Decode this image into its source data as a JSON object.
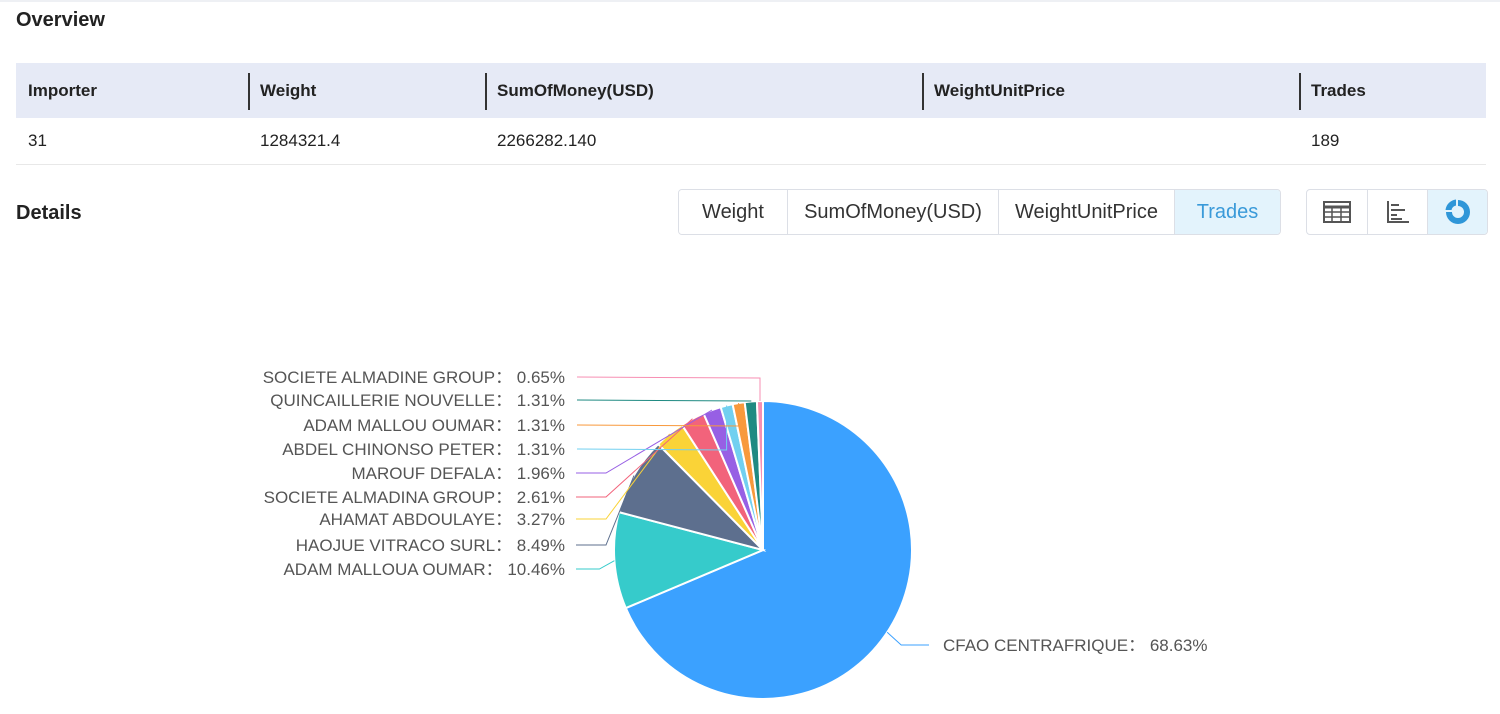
{
  "overview": {
    "title": "Overview",
    "columns": [
      "Importer",
      "Weight",
      "SumOfMoney(USD)",
      "WeightUnitPrice",
      "Trades"
    ],
    "row": [
      "31",
      "1284321.4",
      "2266282.140",
      "",
      "189"
    ]
  },
  "details": {
    "title": "Details",
    "metric_tabs": [
      "Weight",
      "SumOfMoney(USD)",
      "WeightUnitPrice",
      "Trades"
    ],
    "active_metric": "Trades",
    "view_icons": [
      "table-view-icon",
      "bar-chart-icon",
      "pie-chart-icon"
    ],
    "active_view": "pie-chart-icon"
  },
  "chart_data": {
    "type": "pie",
    "series": [
      {
        "label": "CFAO CENTRAFRIQUE",
        "value": 68.63,
        "display": "68.63%",
        "color": "#3ba1ff"
      },
      {
        "label": "ADAM MALLOUA OUMAR",
        "value": 10.46,
        "display": "10.46%",
        "color": "#36cbcb"
      },
      {
        "label": "HAOJUE VITRACO SURL",
        "value": 8.49,
        "display": "8.49%",
        "color": "#5d6f8e"
      },
      {
        "label": "AHAMAT ABDOULAYE",
        "value": 3.27,
        "display": "3.27%",
        "color": "#fad337"
      },
      {
        "label": "SOCIETE ALMADINA GROUP",
        "value": 2.61,
        "display": "2.61%",
        "color": "#f2637b"
      },
      {
        "label": "MAROUF DEFALA",
        "value": 1.96,
        "display": "1.96%",
        "color": "#975fe4"
      },
      {
        "label": "ABDEL CHINONSO PETER",
        "value": 1.31,
        "display": "1.31%",
        "color": "#72d0f0"
      },
      {
        "label": "ADAM MALLOU OUMAR",
        "value": 1.31,
        "display": "1.31%",
        "color": "#f8993c"
      },
      {
        "label": "QUINCAILLERIE NOUVELLE",
        "value": 1.31,
        "display": "1.31%",
        "color": "#1f8a82"
      },
      {
        "label": "SOCIETE ALMADINE GROUP",
        "value": 0.65,
        "display": "0.65%",
        "color": "#f78fb3"
      }
    ]
  }
}
